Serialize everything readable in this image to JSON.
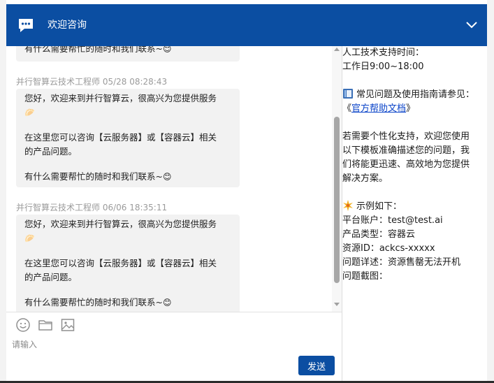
{
  "header": {
    "title": "欢迎咨询",
    "chat_icon": "chat-bubble-icon",
    "collapse_icon": "chevron-down-icon",
    "accent": "#0b4ea2"
  },
  "chat": {
    "partial_message": {
      "line": "有什么需要帮忙的随时和我们联系~",
      "emoji": "😊"
    },
    "messages": [
      {
        "sender": "并行智算云技术工程师 05/28 08:28:43",
        "greeting": "您好，欢迎来到并行智算云，很高兴为您提供服务",
        "greeting_emoji": "🥟",
        "body_line1": "在这里您可以咨询【云服务器】或【容器云】相关",
        "body_line2": "的产品问题。",
        "closing": "有什么需要帮忙的随时和我们联系~",
        "closing_emoji": "😊"
      },
      {
        "sender": "并行智算云技术工程师 06/06 18:35:11",
        "greeting": "您好，欢迎来到并行智算云，很高兴为您提供服务",
        "greeting_emoji": "🥟",
        "body_line1": "在这里您可以咨询【云服务器】或【容器云】相关",
        "body_line2": "的产品问题。",
        "closing": "有什么需要帮忙的随时和我们联系~",
        "closing_emoji": "😊"
      }
    ]
  },
  "compose": {
    "placeholder": "请输入",
    "send_label": "发送",
    "tools": [
      "smiley-icon",
      "folder-icon",
      "image-icon"
    ]
  },
  "info": {
    "support_hours_label": "人工技术支持时间：",
    "support_hours": "工作日9:00~18:00",
    "faq_prefix": "常见问题及使用指南请参见：",
    "faq_link_open": "《",
    "faq_link": "官方帮助文档",
    "faq_link_close": "》",
    "custom_line1": "若需要个性化支持，欢迎您使用",
    "custom_line2": "以下模板准确描述您的问题，我",
    "custom_line3": "们将能更迅速、高效地为您提供",
    "custom_line4": "解决方案。",
    "example_title": "示例如下：",
    "example_account": "平台账户：test@test.ai",
    "example_type": "产品类型：容器云",
    "example_id": "资源ID：ackcs-xxxxx",
    "example_detail": "问题详述：资源售罄无法开机",
    "example_screenshot": "问题截图："
  }
}
